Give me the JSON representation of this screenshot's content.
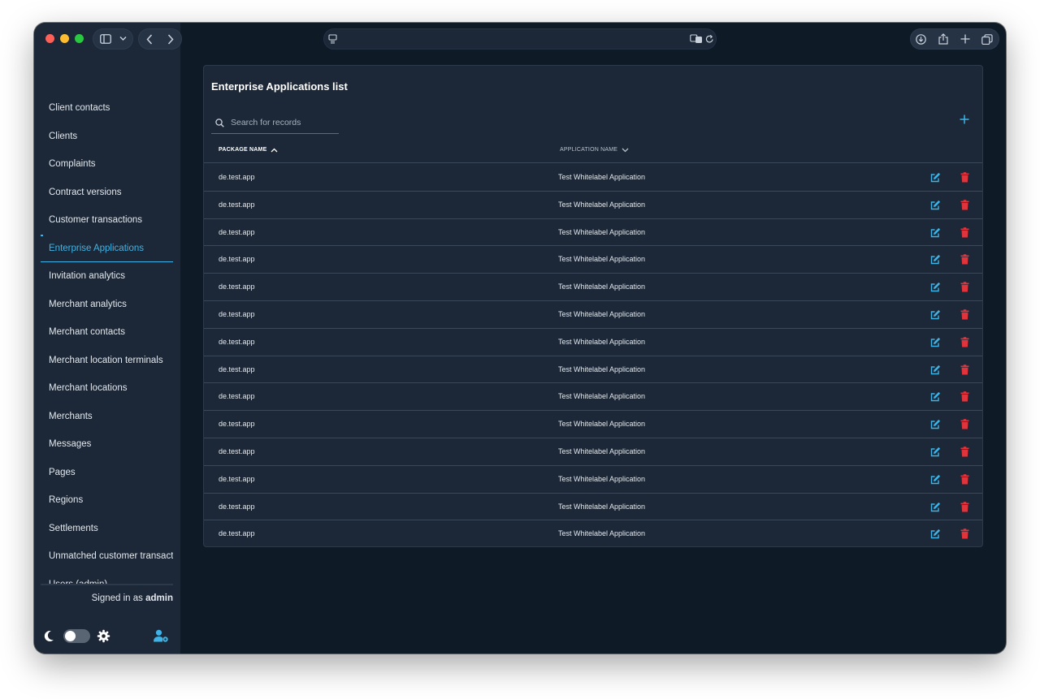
{
  "colors": {
    "accent": "#3fb3e6",
    "danger": "#e0343c",
    "sidebar_bg": "#1c2837",
    "content_bg": "#0f1a27"
  },
  "browser": {
    "icons": [
      "sidebar-icon",
      "chevron-down-icon",
      "back-icon",
      "forward-icon",
      "page-icon",
      "translate-icon",
      "reload-icon",
      "download-icon",
      "share-icon",
      "new-tab-icon",
      "tabs-overview-icon"
    ]
  },
  "sidebar": {
    "items": [
      {
        "label": "Client contacts"
      },
      {
        "label": "Clients"
      },
      {
        "label": "Complaints"
      },
      {
        "label": "Contract versions"
      },
      {
        "label": "Customer transactions"
      },
      {
        "label": "Enterprise Applications",
        "active": true
      },
      {
        "label": "Invitation analytics"
      },
      {
        "label": "Merchant analytics"
      },
      {
        "label": "Merchant contacts"
      },
      {
        "label": "Merchant location terminals"
      },
      {
        "label": "Merchant locations"
      },
      {
        "label": "Merchants"
      },
      {
        "label": "Messages"
      },
      {
        "label": "Pages"
      },
      {
        "label": "Regions"
      },
      {
        "label": "Settlements"
      },
      {
        "label": "Unmatched customer transacti"
      },
      {
        "label": "Users (admin)"
      }
    ],
    "signed_in_prefix": "Signed in as",
    "signed_in_user": "admin",
    "theme_icons": [
      "moon-icon",
      "theme-toggle",
      "settings-icon",
      "user-settings-icon"
    ]
  },
  "main": {
    "title": "Enterprise Applications list",
    "search_placeholder": "Search for records",
    "add_icon": "plus-icon",
    "columns": [
      {
        "label": "PACKAGE NAME",
        "sort": "asc"
      },
      {
        "label": "APPLICATION NAME",
        "sort": "desc"
      }
    ],
    "rows": [
      {
        "package": "de.test.app",
        "app": "Test Whitelabel Application"
      },
      {
        "package": "de.test.app",
        "app": "Test Whitelabel Application"
      },
      {
        "package": "de.test.app",
        "app": "Test Whitelabel Application"
      },
      {
        "package": "de.test.app",
        "app": "Test Whitelabel Application"
      },
      {
        "package": "de.test.app",
        "app": "Test Whitelabel Application"
      },
      {
        "package": "de.test.app",
        "app": "Test Whitelabel Application"
      },
      {
        "package": "de.test.app",
        "app": "Test Whitelabel Application"
      },
      {
        "package": "de.test.app",
        "app": "Test Whitelabel Application"
      },
      {
        "package": "de.test.app",
        "app": "Test Whitelabel Application"
      },
      {
        "package": "de.test.app",
        "app": "Test Whitelabel Application"
      },
      {
        "package": "de.test.app",
        "app": "Test Whitelabel Application"
      },
      {
        "package": "de.test.app",
        "app": "Test Whitelabel Application"
      },
      {
        "package": "de.test.app",
        "app": "Test Whitelabel Application"
      },
      {
        "package": "de.test.app",
        "app": "Test Whitelabel Application"
      }
    ],
    "row_action_icons": [
      "edit-icon",
      "trash-icon"
    ]
  }
}
